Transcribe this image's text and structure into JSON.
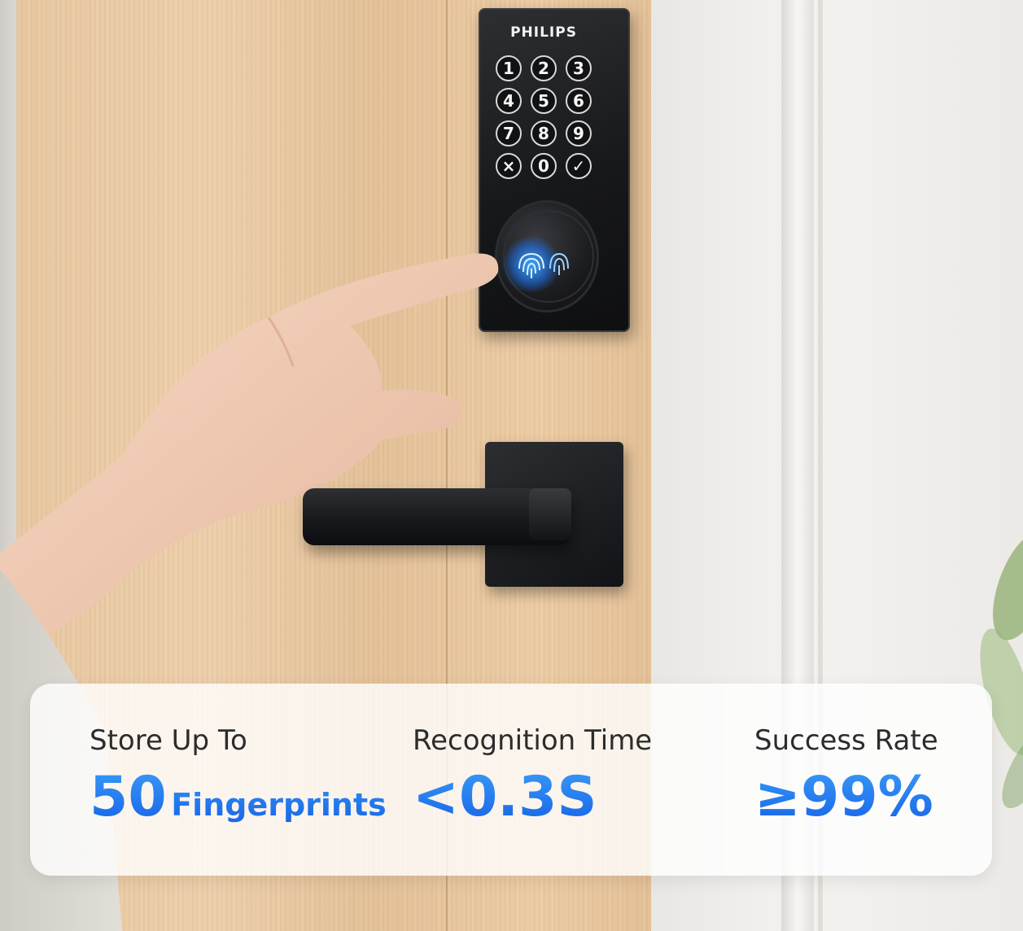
{
  "lock": {
    "brand": "PHILIPS",
    "keys": [
      "1",
      "2",
      "3",
      "4",
      "5",
      "6",
      "7",
      "8",
      "9",
      "×",
      "0",
      "✓"
    ]
  },
  "stats": [
    {
      "label": "Store Up To",
      "number": "50",
      "unit": "Fingerprints"
    },
    {
      "label": "Recognition Time",
      "value": "<0.3S"
    },
    {
      "label": "Success Rate",
      "value": "≥99%"
    }
  ],
  "colors": {
    "accent": "#1f74ec",
    "accent_light": "#3a9cf7",
    "lock_body": "#17181b",
    "door_wood": "#e7c8a2"
  }
}
